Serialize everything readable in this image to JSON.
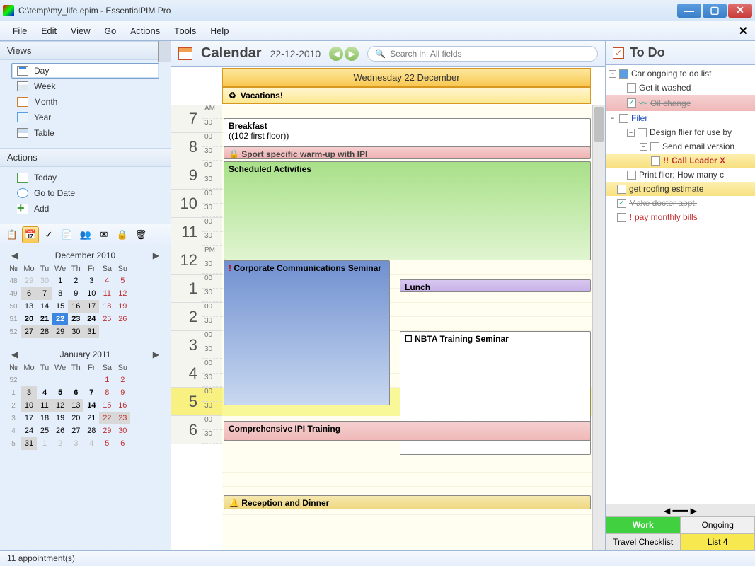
{
  "window": {
    "title": "C:\\temp\\my_life.epim - EssentialPIM Pro"
  },
  "menu": [
    "File",
    "Edit",
    "View",
    "Go",
    "Actions",
    "Tools",
    "Help"
  ],
  "sidebar": {
    "views_header": "Views",
    "views": [
      "Day",
      "Week",
      "Month",
      "Year",
      "Table"
    ],
    "actions_header": "Actions",
    "actions": [
      "Today",
      "Go to Date",
      "Add"
    ]
  },
  "minical_dec": {
    "title": "December  2010",
    "cols": [
      "№",
      "Mo",
      "Tu",
      "We",
      "Th",
      "Fr",
      "Sa",
      "Su"
    ]
  },
  "minical_jan": {
    "title": "January  2011",
    "cols": [
      "№",
      "Mo",
      "Tu",
      "We",
      "Th",
      "Fr",
      "Sa",
      "Su"
    ]
  },
  "calendar": {
    "title": "Calendar",
    "date": "22-12-2010",
    "search_placeholder": "Search in: All fields",
    "day_header": "Wednesday 22 December",
    "allday": "Vacations!",
    "hours": [
      "7",
      "8",
      "9",
      "10",
      "11",
      "12",
      "1",
      "2",
      "3",
      "4",
      "5",
      "6"
    ],
    "am": "AM",
    "pm": "PM",
    "events": {
      "breakfast_title": "Breakfast",
      "breakfast_loc": "((102 first floor))",
      "sport": "Sport specific warm-up with IPI",
      "sched": "Scheduled Activities",
      "corp": "Corporate Communications Seminar",
      "lunch": "Lunch",
      "nbta": "NBTA Training Seminar",
      "comp": "Comprehensive IPI Training",
      "recep": "Reception and Dinner"
    }
  },
  "todo": {
    "title": "To Do",
    "items": {
      "car": "Car ongoing to do list",
      "washed": "Get it washed",
      "oil": "Oil change",
      "filer": "Filer",
      "design": "Design flier for use by",
      "send": "Send email version",
      "call": "Call Leader X",
      "print": "Print flier; How many c",
      "roof": "get roofing estimate",
      "doctor": "Make doctor appt.",
      "bills": "pay monthly bills"
    },
    "tabs": [
      "Work",
      "Ongoing",
      "Travel Checklist",
      "List 4"
    ]
  },
  "status": "11 appointment(s)"
}
